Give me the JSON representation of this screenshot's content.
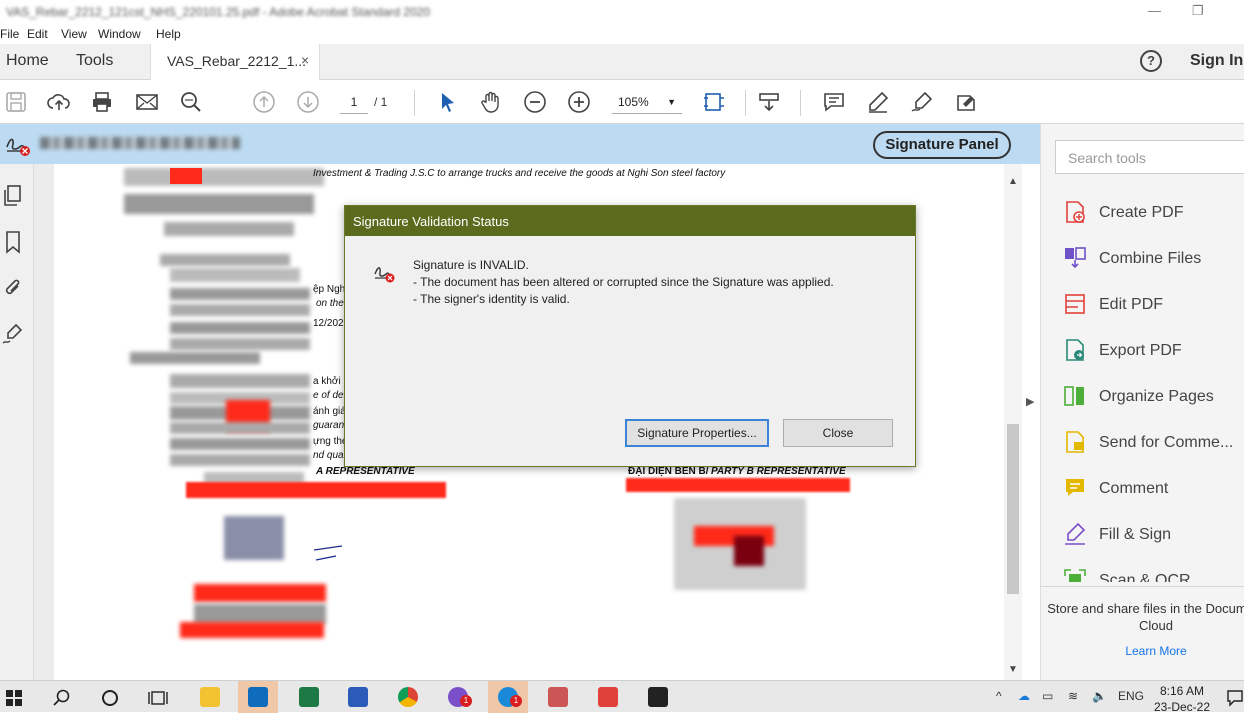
{
  "window": {
    "title": "VAS_Rebar_2212_121cst_NHS_220101.25.pdf - Adobe Acrobat Standard 2020",
    "minimize": "—",
    "restore": "❐"
  },
  "menu": [
    "File",
    "Edit",
    "View",
    "Window",
    "Help"
  ],
  "tabs": {
    "home": "Home",
    "tools": "Tools",
    "document": "VAS_Rebar_2212_1...",
    "close": "×"
  },
  "header": {
    "help": "?",
    "sign_in": "Sign In"
  },
  "toolbar": {
    "page_current": "1",
    "page_total": "/ 1",
    "zoom": "105%"
  },
  "signature_bar": {
    "panel_button": "Signature Panel"
  },
  "document": {
    "line_top": "Investment & Trading J.S.C to arrange trucks and receive the goods at Nghi Son steel factory",
    "frag_1": "ệp Nghi",
    "frag_2": "on the",
    "frag_3": "12/202",
    "frag_4": "a khởi n",
    "frag_5": "e of deli",
    "frag_6": "ánh giá",
    "frag_7": "guaran",
    "frag_8": "ựng the",
    "frag_9": "nd quan",
    "party_a": "A REPRESENTATIVE",
    "party_b_prefix": "ĐẠI DIỆN BÊN B/",
    "party_b": "PARTY B REPRESENTATIVE"
  },
  "dialog": {
    "title": "Signature Validation Status",
    "line1": "Signature is INVALID.",
    "line2": "- The document has been altered or corrupted since the Signature was applied.",
    "line3": "- The signer's identity is valid.",
    "btn_properties": "Signature Properties...",
    "btn_close": "Close"
  },
  "right_panel": {
    "search_placeholder": "Search tools",
    "tools": [
      {
        "label": "Create PDF",
        "icon": "create-pdf-icon",
        "color": "#e0413b"
      },
      {
        "label": "Combine Files",
        "icon": "combine-files-icon",
        "color": "#6f52c8"
      },
      {
        "label": "Edit PDF",
        "icon": "edit-pdf-icon",
        "color": "#e0413b"
      },
      {
        "label": "Export PDF",
        "icon": "export-pdf-icon",
        "color": "#2a8a7a"
      },
      {
        "label": "Organize Pages",
        "icon": "organize-pages-icon",
        "color": "#4caf3a"
      },
      {
        "label": "Send for Comme...",
        "icon": "send-for-comment-icon",
        "color": "#e5b800"
      },
      {
        "label": "Comment",
        "icon": "comment-icon",
        "color": "#e5b800"
      },
      {
        "label": "Fill & Sign",
        "icon": "fill-sign-icon",
        "color": "#7a4fc9"
      },
      {
        "label": "Scan & OCR",
        "icon": "scan-ocr-icon",
        "color": "#4caf3a"
      }
    ],
    "cloud_text": "Store and share files in the Document Cloud",
    "learn_more": "Learn More"
  },
  "taskbar": {
    "lang": "ENG",
    "time": "8:16 AM",
    "date": "23-Dec-22",
    "badge_count": "1"
  },
  "colors": {
    "accent_blue": "#1473e6",
    "sig_bar": "#bcdaf1",
    "dialog_title": "#5b6b1e",
    "invalid_red": "#d81e1e"
  }
}
